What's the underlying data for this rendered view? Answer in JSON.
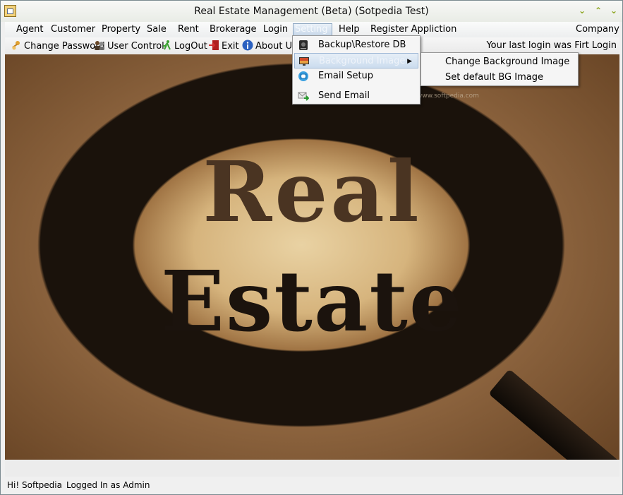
{
  "window": {
    "title": "Real Estate Management (Beta) (Sotpedia Test)"
  },
  "menubar": {
    "items": [
      {
        "label": "Agent"
      },
      {
        "label": "Customer"
      },
      {
        "label": "Property"
      },
      {
        "label": "Sale"
      },
      {
        "label": "Rent"
      },
      {
        "label": "Brokerage"
      },
      {
        "label": "Login"
      },
      {
        "label": "Setting"
      },
      {
        "label": "Help"
      },
      {
        "label": "Register Appliction"
      }
    ],
    "right_item": "Company"
  },
  "toolbar": {
    "items": [
      {
        "label": "Change Password",
        "icon": "key-user-icon"
      },
      {
        "label": "User Control",
        "icon": "users-icon"
      },
      {
        "label": "LogOut",
        "icon": "runner-icon"
      },
      {
        "label": "Exit",
        "icon": "exit-door-icon"
      },
      {
        "label": "About Us",
        "icon": "info-icon"
      }
    ],
    "login_note": "Your last login was Firt Login"
  },
  "setting_menu": {
    "items": [
      {
        "label": "Backup\\Restore DB",
        "icon": "database-icon"
      },
      {
        "label": "Background Image",
        "icon": "monitor-image-icon",
        "has_submenu": true
      },
      {
        "label": "Email Setup",
        "icon": "email-gear-icon"
      },
      {
        "label": "Send Email",
        "icon": "email-send-icon"
      }
    ]
  },
  "background_submenu": {
    "items": [
      {
        "label": "Change Background Image"
      },
      {
        "label": "Set default BG Image"
      }
    ]
  },
  "background": {
    "line1": "Real",
    "line2": "Estate",
    "watermark": "www.softpedia.com"
  },
  "statusbar": {
    "greeting": "Hi! Softpedia",
    "login_status": "Logged In as Admin"
  },
  "colors": {
    "accent_menu": "#cbdcee",
    "window_controls": "#8aa31a"
  }
}
